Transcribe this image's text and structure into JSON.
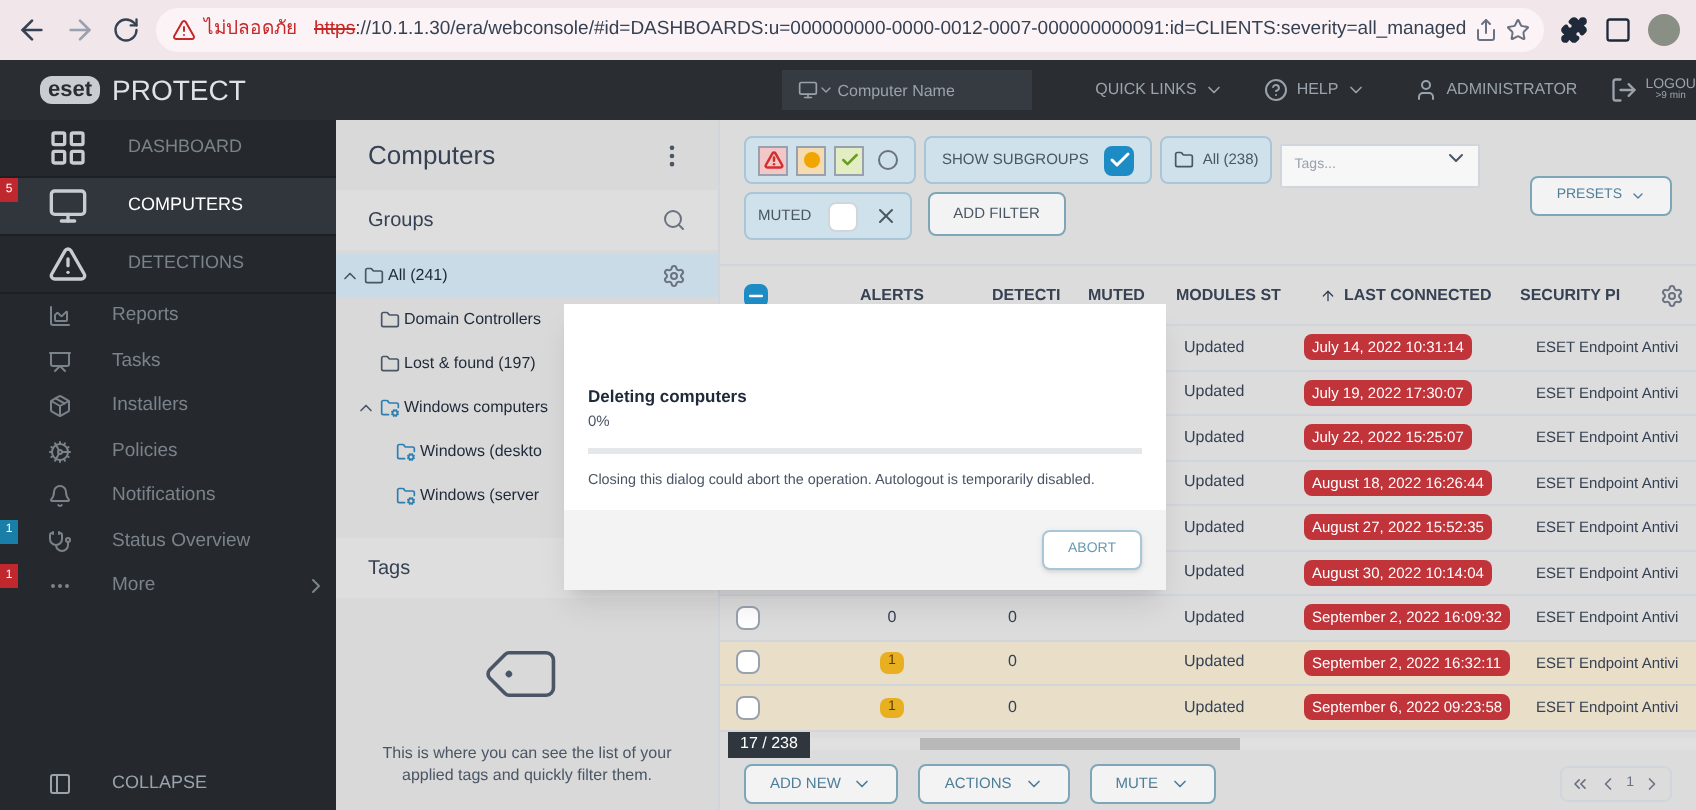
{
  "browser": {
    "security_label": "ไม่ปลอดภัย",
    "url_scheme": "https",
    "url_rest": "://10.1.1.30/era/webconsole/#id=DASHBOARDS:u=000000000-0000-0012-0007-000000000091:id=CLIENTS:severity=all_managed"
  },
  "header": {
    "logo": "eset",
    "product": "PROTECT",
    "search_placeholder": "Computer Name",
    "quick_links": "QUICK LINKS",
    "help": "HELP",
    "user": "ADMINISTRATOR",
    "logout": "LOGOU",
    "logout_time": ">9 min"
  },
  "sidebar": {
    "items": [
      {
        "label": "DASHBOARD",
        "kind": "dashboard",
        "selected": false
      },
      {
        "label": "COMPUTERS",
        "kind": "computers",
        "selected": true,
        "badge": "5",
        "color": "#c0282d"
      },
      {
        "label": "DETECTIONS",
        "kind": "detections",
        "selected": false
      },
      {
        "label": "Reports",
        "kind": "reports",
        "selected": false
      },
      {
        "label": "Tasks",
        "kind": "tasks",
        "selected": false
      },
      {
        "label": "Installers",
        "kind": "installers",
        "selected": false
      },
      {
        "label": "Policies",
        "kind": "policies",
        "selected": false
      },
      {
        "label": "Notifications",
        "kind": "notifications",
        "selected": false
      },
      {
        "label": "Status Overview",
        "kind": "status",
        "selected": false,
        "badge": "1",
        "color": "#1a7fa8"
      },
      {
        "label": "More",
        "kind": "more",
        "selected": false,
        "badge": "1",
        "color": "#c0282d"
      }
    ],
    "collapse": "COLLAPSE"
  },
  "groups_panel": {
    "title": "Computers",
    "groups_heading": "Groups",
    "tree": [
      {
        "label": "All (241)",
        "selected": true,
        "expanded": true,
        "children": [
          {
            "label": "Domain Controllers",
            "kind": "folder"
          },
          {
            "label": "Lost & found (197)",
            "kind": "folder"
          },
          {
            "label": "Windows computers",
            "kind": "dynamic",
            "expanded": true,
            "children": [
              {
                "label": "Windows (deskto",
                "kind": "dynamic"
              },
              {
                "label": "Windows (server",
                "kind": "dynamic"
              }
            ]
          }
        ]
      }
    ],
    "tags_heading": "Tags",
    "tags_empty": "This is where you can see the list of your applied tags and quickly filter them."
  },
  "filters": {
    "severity": [
      {
        "kind": "error",
        "selected": true
      },
      {
        "kind": "warning",
        "selected": true
      },
      {
        "kind": "ok",
        "selected": true
      },
      {
        "kind": "none",
        "selected": false
      }
    ],
    "show_subgroups": {
      "label": "SHOW SUBGROUPS",
      "checked": true
    },
    "group": "All (238)",
    "tags_placeholder": "Tags...",
    "muted": {
      "label": "MUTED",
      "checked": false
    },
    "add_filter": "ADD FILTER",
    "presets": "PRESETS"
  },
  "table": {
    "select_all_partial": true,
    "columns": [
      "ALERTS",
      "DETECTI",
      "MUTED",
      "MODULES ST",
      "LAST CONNECTED",
      "SECURITY PI"
    ],
    "rows": [
      {
        "modules": "Updated",
        "last_connected": "July 14, 2022 10:31:14",
        "product": "ESET Endpoint Antivi",
        "highlighted": false
      },
      {
        "modules": "Updated",
        "last_connected": "July 19, 2022 17:30:07",
        "product": "ESET Endpoint Antivi",
        "highlighted": false
      },
      {
        "modules": "Updated",
        "last_connected": "July 22, 2022 15:25:07",
        "product": "ESET Endpoint Antivi",
        "highlighted": false
      },
      {
        "modules": "Updated",
        "last_connected": "August 18, 2022 16:26:44",
        "product": "ESET Endpoint Antivi",
        "highlighted": false
      },
      {
        "modules": "Updated",
        "last_connected": "August 27, 2022 15:52:35",
        "product": "ESET Endpoint Antivi",
        "highlighted": false
      },
      {
        "modules": "Updated",
        "last_connected": "August 30, 2022 10:14:04",
        "product": "ESET Endpoint Antivi",
        "highlighted": false
      },
      {
        "selected": false,
        "alerts": "0",
        "alert_badge": false,
        "detections": "0",
        "modules": "Updated",
        "last_connected": "September 2, 2022 16:09:32",
        "product": "ESET Endpoint Antivi",
        "highlighted": false
      },
      {
        "selected": false,
        "alerts": "1",
        "alert_badge": true,
        "detections": "0",
        "modules": "Updated",
        "last_connected": "September 2, 2022 16:32:11",
        "product": "ESET Endpoint Antivi",
        "highlighted": true
      },
      {
        "selected": false,
        "alerts": "1",
        "alert_badge": true,
        "detections": "0",
        "modules": "Updated",
        "last_connected": "September 6, 2022 09:23:58",
        "product": "ESET Endpoint Antivi",
        "highlighted": true
      }
    ],
    "count": "17 / 238",
    "page": "1"
  },
  "actions": [
    "ADD NEW",
    "ACTIONS",
    "MUTE"
  ],
  "dialog": {
    "title": "Deleting computers",
    "percent": "0%",
    "level": 0,
    "message": "Closing this dialog could abort the operation. Autologout is temporarily disabled.",
    "abort": "ABORT"
  }
}
